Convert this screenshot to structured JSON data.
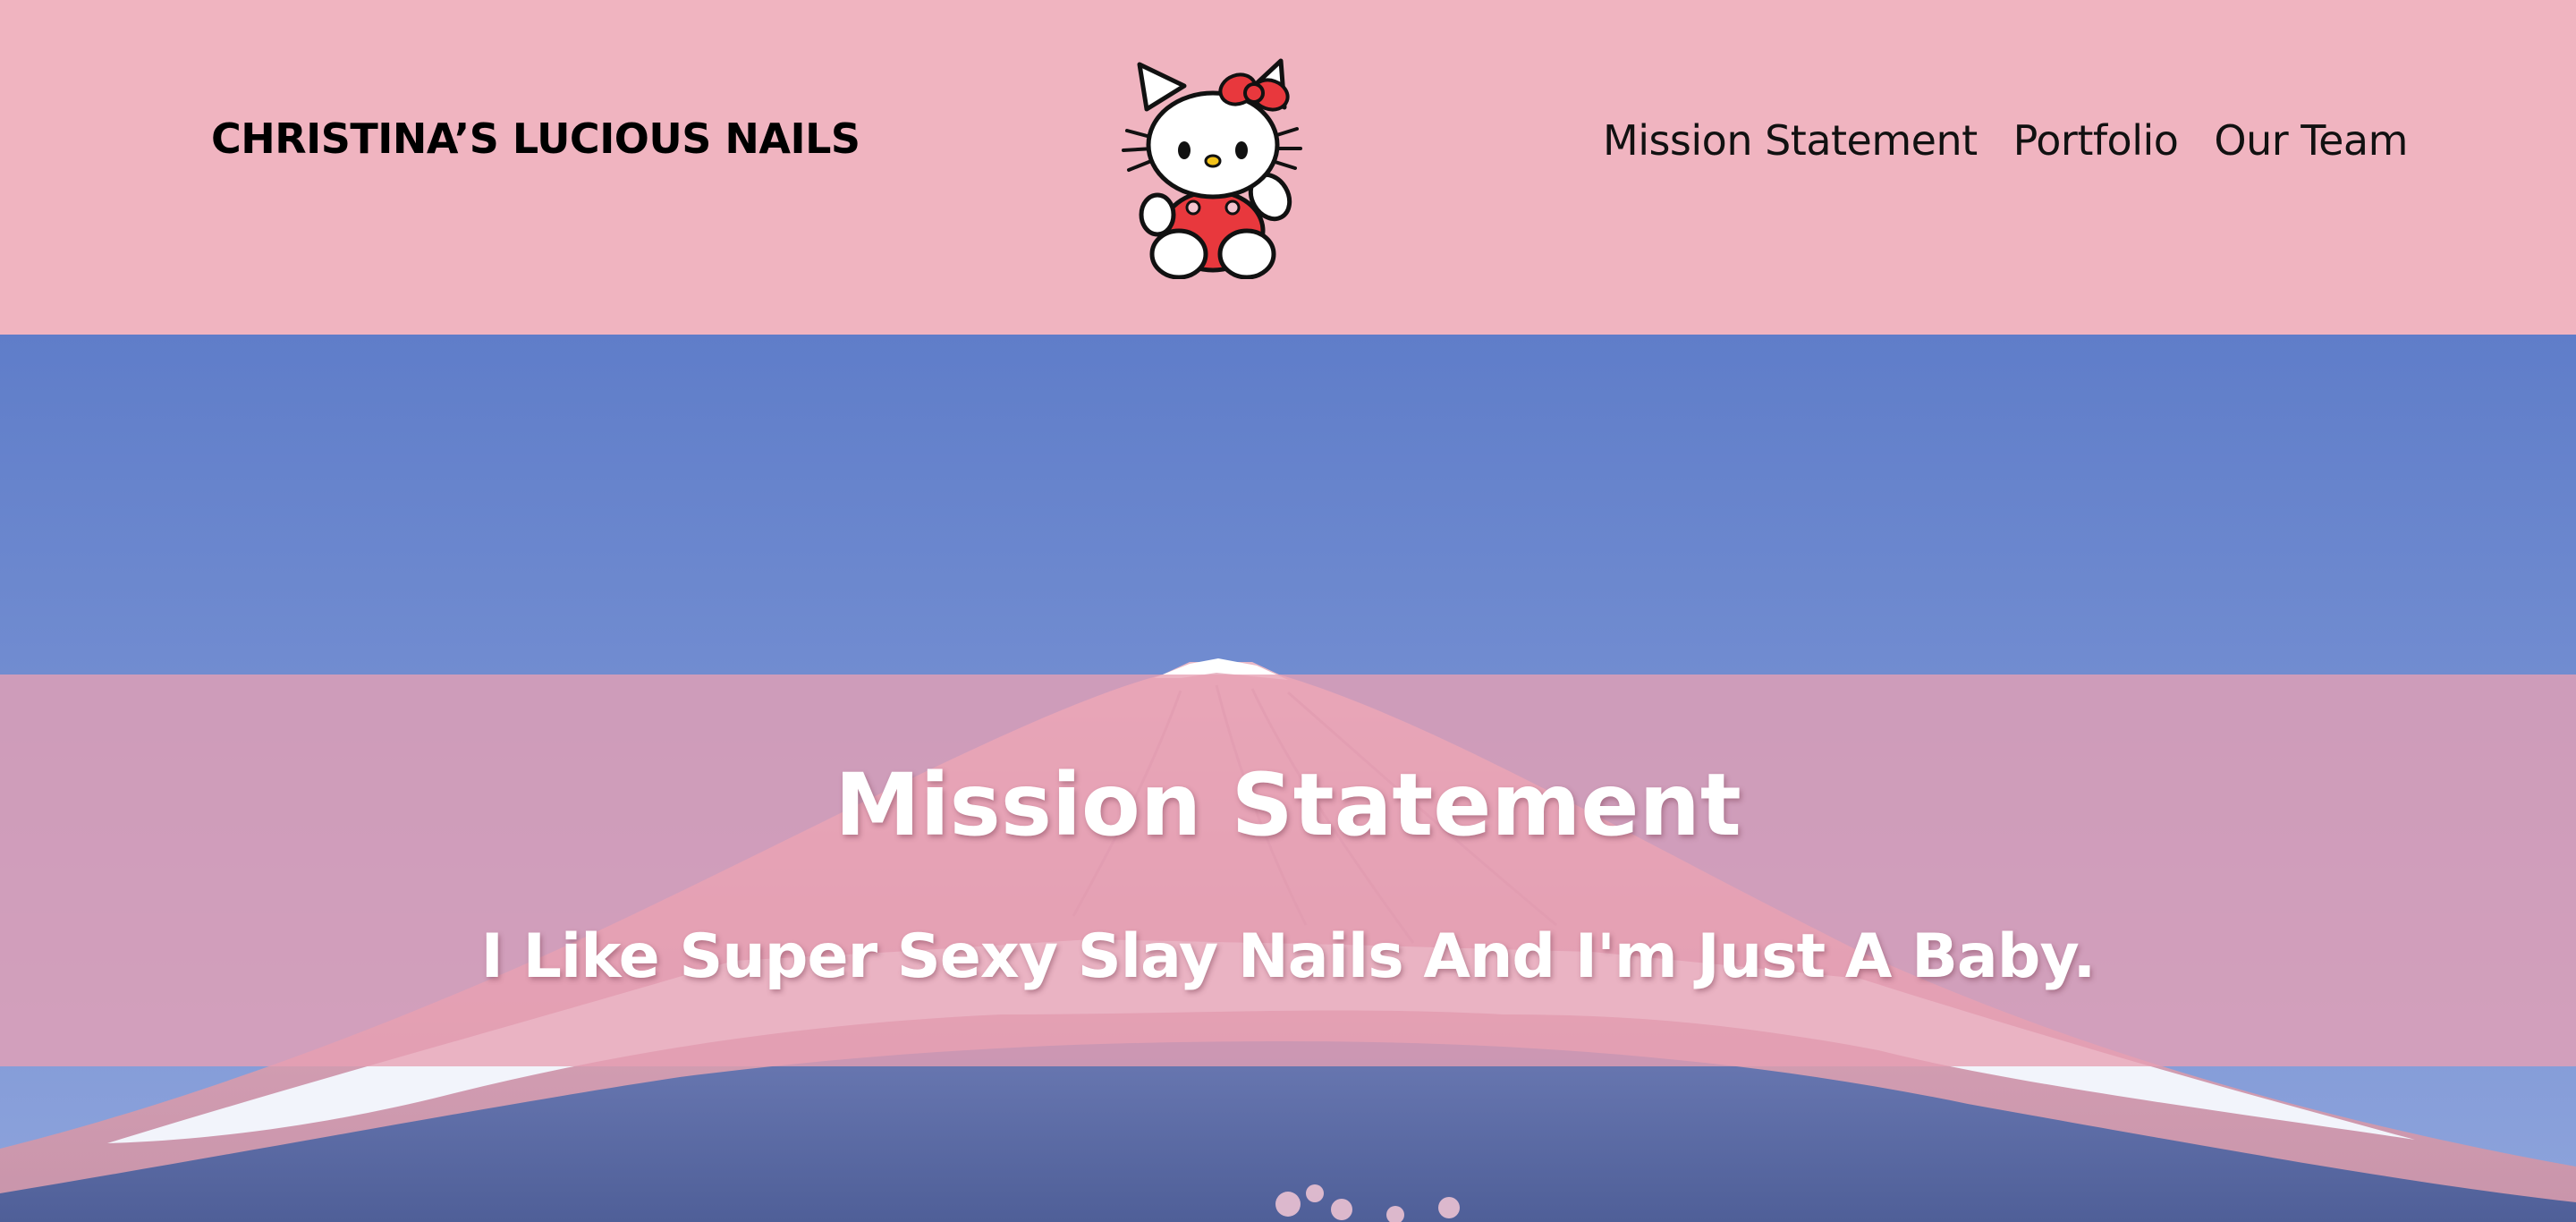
{
  "header": {
    "brand": "CHRISTINA’S LUCIOUS NAILS",
    "logo_icon": "hello-kitty-logo",
    "nav": [
      {
        "label": "Mission Statement"
      },
      {
        "label": "Portfolio"
      },
      {
        "label": "Our Team"
      }
    ],
    "background": "#f0b4c0"
  },
  "hero": {
    "background_image": "mount-fuji-photo",
    "title": "Mission Statement",
    "subtitle": "I Like Super Sexy Slay Nails And I'm Just A Baby.",
    "overlay_color": "#e8a0b4"
  }
}
